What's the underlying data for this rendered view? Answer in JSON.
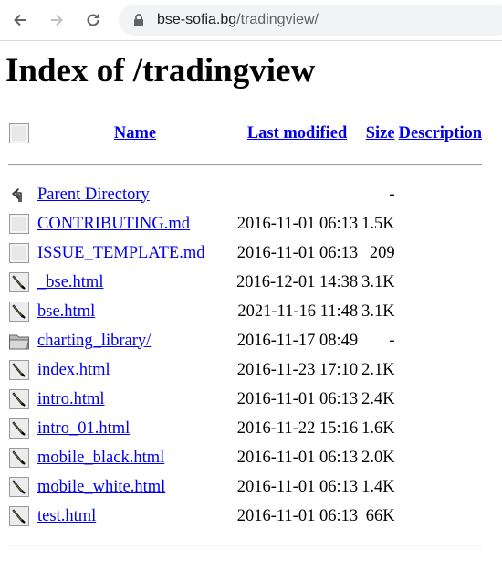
{
  "browser": {
    "url_host": "bse-sofia.bg",
    "url_path": "/tradingview/"
  },
  "page": {
    "title": "Index of /tradingview"
  },
  "table": {
    "headers": {
      "name": "Name",
      "last_modified": "Last modified",
      "size": "Size",
      "description": "Description"
    },
    "rows": [
      {
        "icon": "back-icon",
        "name": "Parent Directory",
        "modified": "",
        "size": "-"
      },
      {
        "icon": "file-icon",
        "name": "CONTRIBUTING.md",
        "modified": "2016-11-01 06:13",
        "size": "1.5K"
      },
      {
        "icon": "file-icon",
        "name": "ISSUE_TEMPLATE.md",
        "modified": "2016-11-01 06:13",
        "size": "209"
      },
      {
        "icon": "html-file-icon",
        "name": "_bse.html",
        "modified": "2016-12-01 14:38",
        "size": "3.1K"
      },
      {
        "icon": "html-file-icon",
        "name": "bse.html",
        "modified": "2021-11-16 11:48",
        "size": "3.1K"
      },
      {
        "icon": "folder-icon",
        "name": "charting_library/",
        "modified": "2016-11-17 08:49",
        "size": "-"
      },
      {
        "icon": "html-file-icon",
        "name": "index.html",
        "modified": "2016-11-23 17:10",
        "size": "2.1K"
      },
      {
        "icon": "html-file-icon",
        "name": "intro.html",
        "modified": "2016-11-01 06:13",
        "size": "2.4K"
      },
      {
        "icon": "html-file-icon",
        "name": "intro_01.html",
        "modified": "2016-11-22 15:16",
        "size": "1.6K"
      },
      {
        "icon": "html-file-icon",
        "name": "mobile_black.html",
        "modified": "2016-11-01 06:13",
        "size": "2.0K"
      },
      {
        "icon": "html-file-icon",
        "name": "mobile_white.html",
        "modified": "2016-11-01 06:13",
        "size": "1.4K"
      },
      {
        "icon": "html-file-icon",
        "name": "test.html",
        "modified": "2016-11-01 06:13",
        "size": "66K"
      }
    ]
  }
}
